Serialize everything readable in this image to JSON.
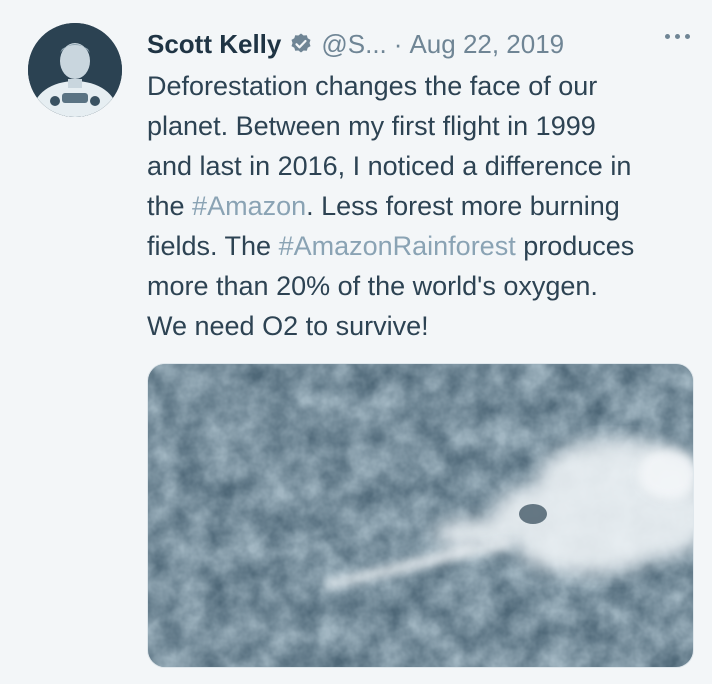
{
  "tweet": {
    "author_name": "Scott Kelly",
    "handle": "@S...",
    "separator": "·",
    "date": "Aug 22, 2019",
    "verified_icon": "verified-badge-icon",
    "more_icon": "more-dots-icon",
    "text_lines": [
      [
        "Deforestation changes the face of our"
      ],
      [
        "planet. Between my first flight in 1999"
      ],
      [
        "and last in 2016, I noticed a difference in"
      ],
      [
        "the ",
        "#Amazon",
        ". Less forest more burning"
      ],
      [
        "fields. The ",
        "#AmazonRainforest",
        " produces"
      ],
      [
        "more than 20% of the world's oxygen."
      ],
      [
        "We need O2 to survive!"
      ]
    ],
    "hashtags": [
      "#Amazon",
      "#AmazonRainforest"
    ]
  },
  "colors": {
    "text": "#2d4353",
    "muted": "#6f8595",
    "hashtag": "#8aa3b4",
    "background": "#f3f6f8"
  }
}
